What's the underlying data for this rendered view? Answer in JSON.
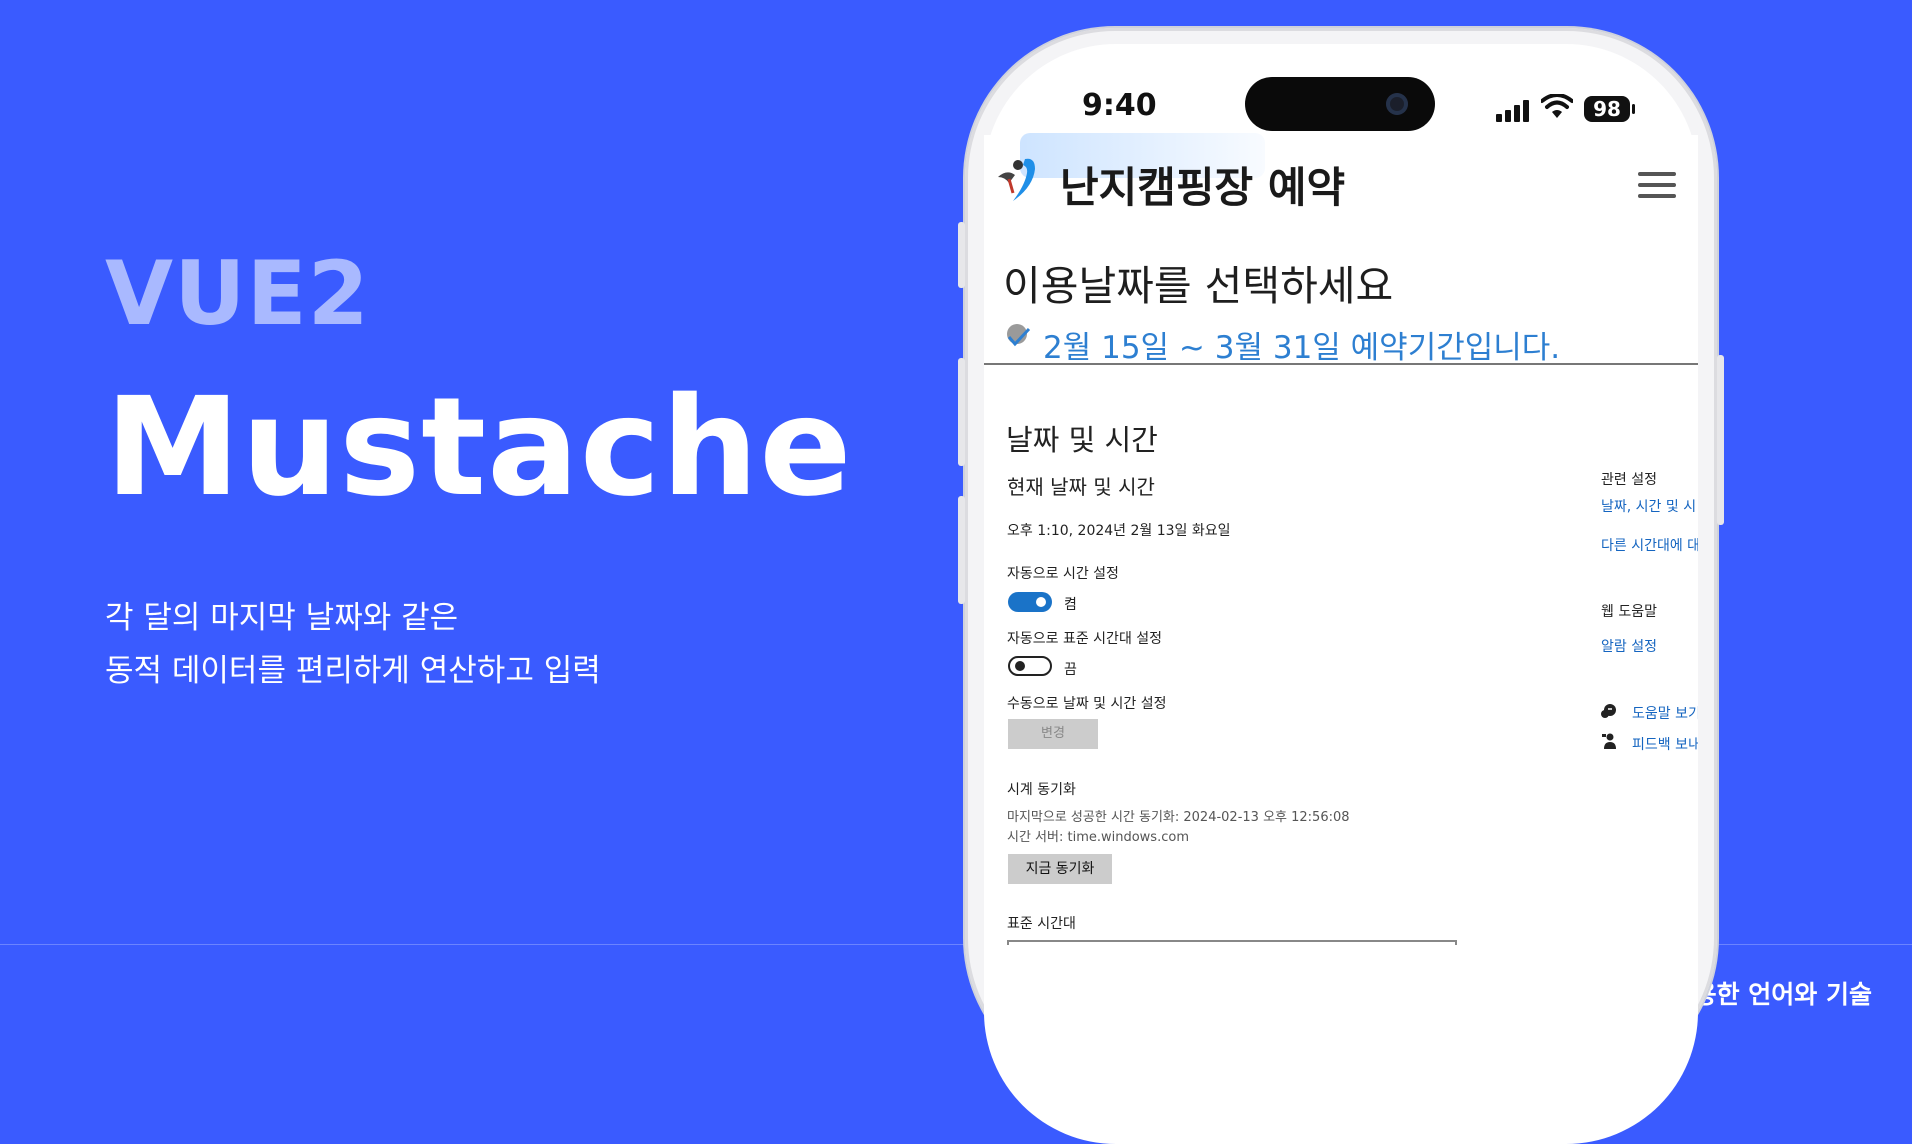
{
  "hero": {
    "framework": "VUE2",
    "feature": "Mustache",
    "desc_line1": "각 달의 마지막 날짜와 같은",
    "desc_line2": "동적 데이터를 편리하게 연산하고 입력"
  },
  "footer": {
    "label": "사용한 언어와 기술"
  },
  "status_bar": {
    "time": "9:40",
    "battery": "98"
  },
  "app": {
    "title": "난지캠핑장 예약",
    "select_date": "이용날짜를 선택하세요",
    "period": "2월 15일 ~ 3월 31일  예약기간입니다."
  },
  "settings": {
    "section_title": "날짜 및 시간",
    "current_heading": "현재 날짜 및 시간",
    "current_value": "오후 1:10, 2024년 2월 13일 화요일",
    "auto_time_label": "자동으로 시간 설정",
    "auto_time_state": "켬",
    "auto_tz_label": "자동으로 표준 시간대 설정",
    "auto_tz_state": "끔",
    "manual_label": "수동으로 날짜 및 시간 설정",
    "change_button": "변경",
    "sync_heading": "시계 동기화",
    "last_sync": "마지막으로 성공한 시간 동기화: 2024-02-13 오후 12:56:08",
    "time_server": "시간 서버: time.windows.com",
    "sync_button": "지금 동기화",
    "timezone_heading": "표준 시간대",
    "related_heading": "관련 설정",
    "related_link1": "날짜, 시간 및 시",
    "related_link2": "다른 시간대에 대",
    "web_help_heading": "웹 도움말",
    "alarm_link": "알람 설정",
    "help_link": "도움말 보기",
    "feedback_link": "피드백 보내"
  },
  "colors": {
    "background": "#3a5bff",
    "link": "#1565c0",
    "toggle_on": "#1a73c8"
  }
}
